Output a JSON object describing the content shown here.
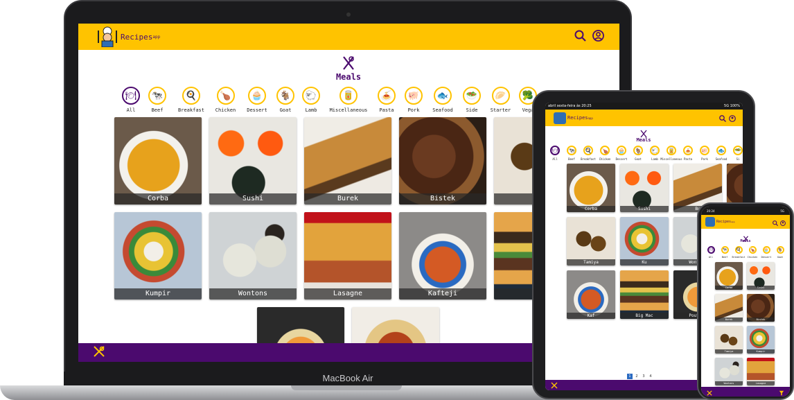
{
  "app": {
    "name": "Recipes",
    "suffix": "app"
  },
  "laptop_label": "MacBook Air",
  "section_title": "Meals",
  "icons": {
    "meals": "fork-knife-icon",
    "search": "search-icon",
    "profile": "profile-icon",
    "footer": "drink-icon",
    "filter": "filter-icon"
  },
  "colors": {
    "header": "#ffc300",
    "footer": "#4b0a6e",
    "accent": "#4b0a6e"
  },
  "categories": [
    {
      "label": "All",
      "glyph": "🍽"
    },
    {
      "label": "Beef",
      "glyph": "🐄"
    },
    {
      "label": "Breakfast",
      "glyph": "🍳"
    },
    {
      "label": "Chicken",
      "glyph": "🍗"
    },
    {
      "label": "Dessert",
      "glyph": "🧁"
    },
    {
      "label": "Goat",
      "glyph": "🐐"
    },
    {
      "label": "Lamb",
      "glyph": "🐑"
    },
    {
      "label": "Miscellaneous",
      "glyph": "🥫"
    },
    {
      "label": "Pasta",
      "glyph": "🍝"
    },
    {
      "label": "Pork",
      "glyph": "🐖"
    },
    {
      "label": "Seafood",
      "glyph": "🐟"
    },
    {
      "label": "Side",
      "glyph": "🥗"
    },
    {
      "label": "Starter",
      "glyph": "🥟"
    },
    {
      "label": "Vega",
      "glyph": "🥦"
    }
  ],
  "laptop_meals": [
    "Corba",
    "Sushi",
    "Burek",
    "Bistek",
    "Ta",
    "Kumpir",
    "Wontons",
    "Lasagne",
    "Kafteji",
    "Bi",
    "",
    ""
  ],
  "tablet_status": {
    "left": "abril sexta-feira às 20:25",
    "right": "5G 100%"
  },
  "tablet_categories": [
    "All",
    "Beef",
    "Breakfast",
    "Chicken",
    "Dessert",
    "Goat",
    "Lamb",
    "Miscellaneous",
    "Pasta",
    "Pork",
    "Seafood",
    "Si"
  ],
  "tablet_meals": [
    "Corba",
    "Sushi",
    "Bu",
    "Bistek",
    "Tamiya",
    "Ku",
    "Wontons",
    "Lasagne",
    "Kaf",
    "Big Mac",
    "Poutine",
    "Kos"
  ],
  "tablet_pages": [
    "1",
    "2",
    "3",
    "4"
  ],
  "phone_status": {
    "left": "20:24",
    "right": "5G"
  },
  "phone_categories": [
    "All",
    "Beef",
    "Breakfast",
    "Chicken",
    "Dessert",
    "Goat"
  ],
  "phone_meals": [
    "Corba",
    "Sushi",
    "Burek",
    "Bistek",
    "Tamiya",
    "Kumpir",
    "Wontons",
    "Lasagne"
  ]
}
